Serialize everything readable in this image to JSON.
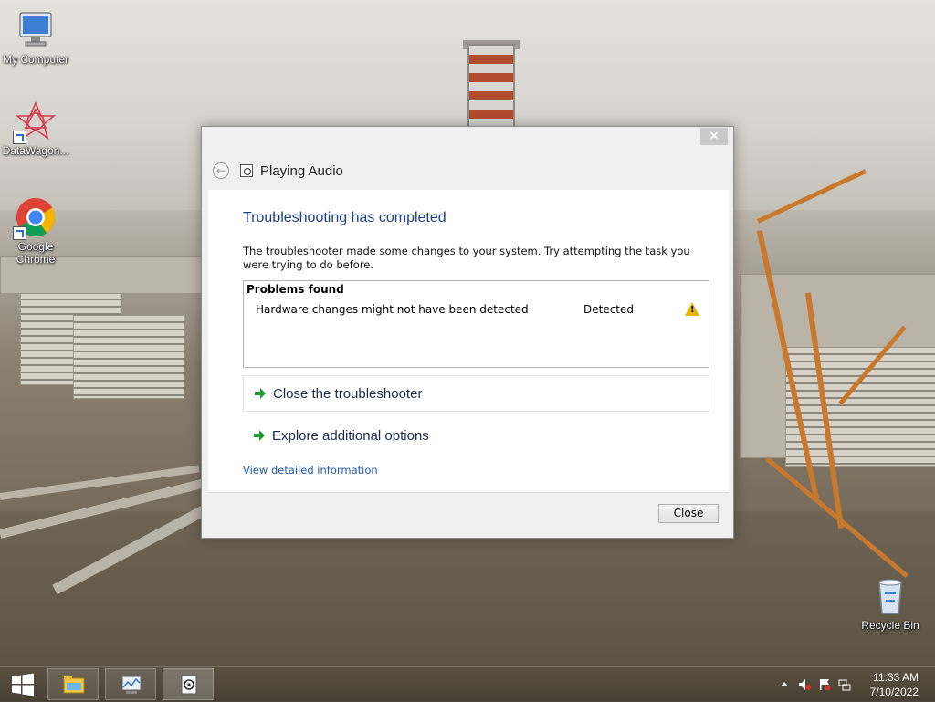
{
  "desktop": {
    "icons": [
      {
        "name": "My Computer"
      },
      {
        "name": "DataWagon..."
      },
      {
        "name": "Google Chrome"
      },
      {
        "name": "Recycle Bin"
      }
    ]
  },
  "dialog": {
    "close_glyph": "×",
    "nav_title": "Playing Audio",
    "heading": "Troubleshooting has completed",
    "description": "The troubleshooter made some changes to your system. Try attempting the task you were trying to do before.",
    "problems": {
      "header": "Problems found",
      "rows": [
        {
          "name": "Hardware changes might not have been detected",
          "status": "Detected",
          "icon": "warning-icon"
        }
      ]
    },
    "commands": [
      {
        "label": "Close the troubleshooter"
      },
      {
        "label": "Explore additional options"
      }
    ],
    "link": "View detailed information",
    "close_button": "Close"
  },
  "taskbar": {
    "time": "11:33 AM",
    "date": "7/10/2022",
    "apps": [
      "file-explorer-icon",
      "performance-monitor-icon",
      "troubleshooter-icon"
    ]
  }
}
